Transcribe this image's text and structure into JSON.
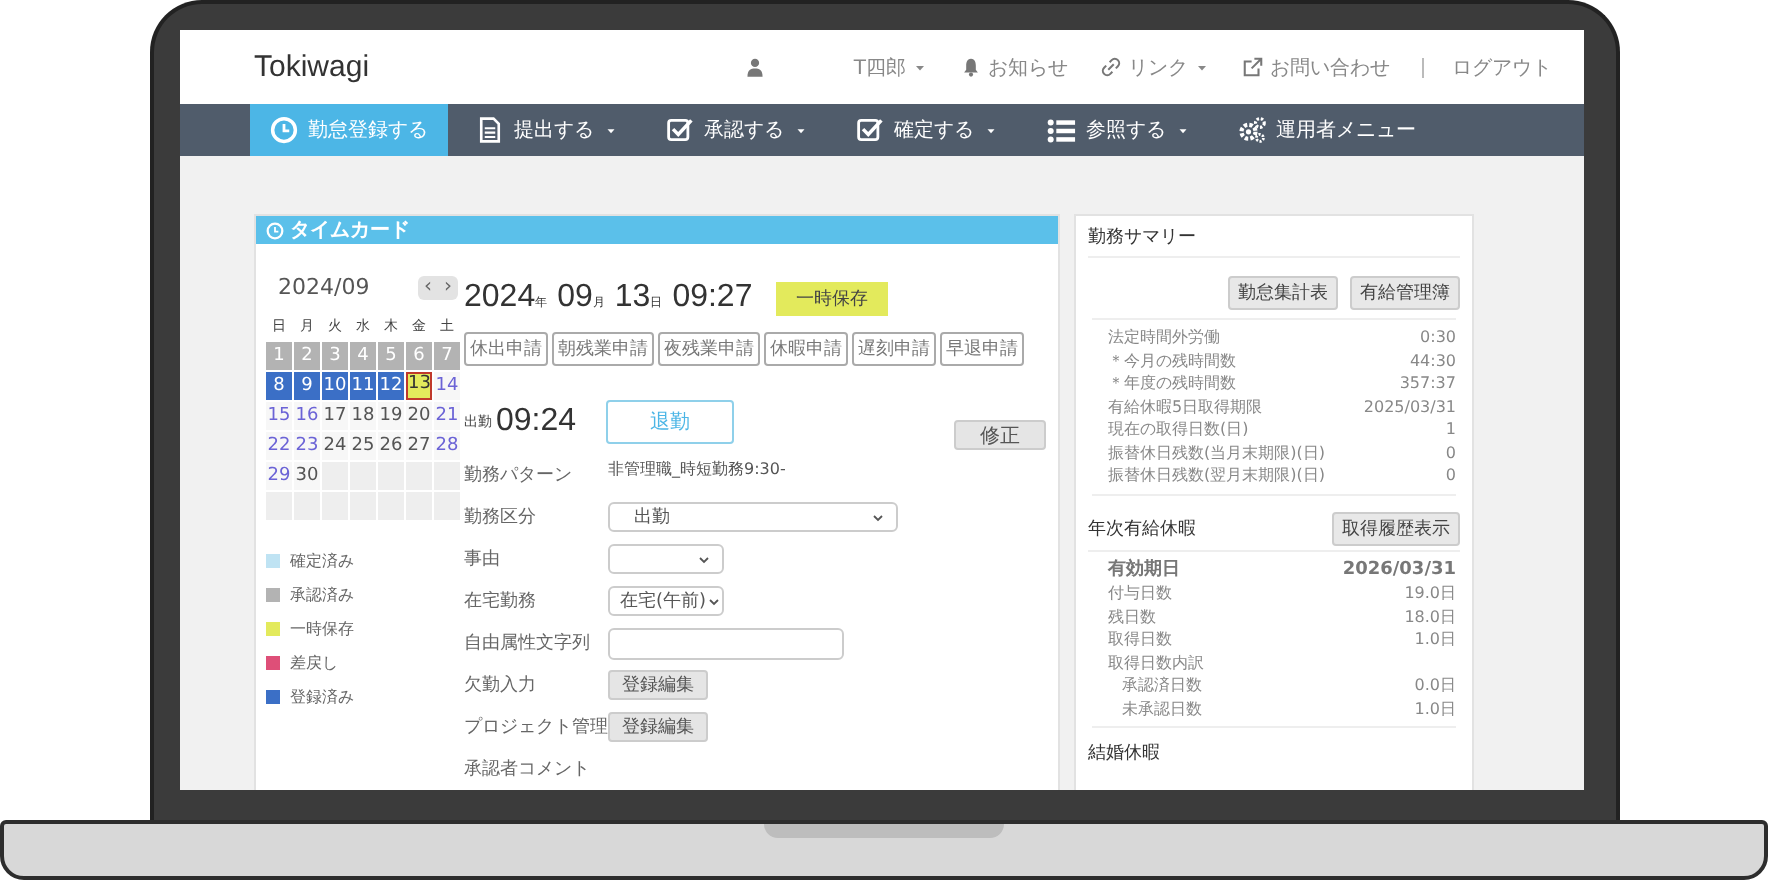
{
  "header": {
    "logo": "Tokiwagi",
    "user_name": "T四郎",
    "links": [
      {
        "label": "お知らせ",
        "kind": "bell",
        "dropdown": false
      },
      {
        "label": "リンク",
        "kind": "link",
        "dropdown": true
      },
      {
        "label": "お問い合わせ",
        "kind": "external",
        "dropdown": false
      },
      {
        "label": "ログアウト",
        "kind": "plain",
        "dropdown": false
      }
    ]
  },
  "nav": [
    {
      "label": "勤怠登録する",
      "kind": "clock",
      "dropdown": false,
      "selected": true
    },
    {
      "label": "提出する",
      "kind": "doc",
      "dropdown": true,
      "selected": false
    },
    {
      "label": "承認する",
      "kind": "check",
      "dropdown": true,
      "selected": false
    },
    {
      "label": "確定する",
      "kind": "check",
      "dropdown": true,
      "selected": false
    },
    {
      "label": "参照する",
      "kind": "list",
      "dropdown": true,
      "selected": false
    },
    {
      "label": "運用者メニュー",
      "kind": "gears",
      "dropdown": false,
      "selected": false
    }
  ],
  "timecard": {
    "title": "タイムカード",
    "month": "2024/09",
    "prev": "‹",
    "next": "›",
    "weekdays": [
      "日",
      "月",
      "火",
      "水",
      "木",
      "金",
      "土"
    ],
    "days": [
      {
        "day": "1",
        "kind": "approved",
        "holiday": false,
        "today": false
      },
      {
        "day": "2",
        "kind": "approved",
        "holiday": false,
        "today": false
      },
      {
        "day": "3",
        "kind": "approved",
        "holiday": false,
        "today": false
      },
      {
        "day": "4",
        "kind": "approved",
        "holiday": false,
        "today": false
      },
      {
        "day": "5",
        "kind": "approved",
        "holiday": false,
        "today": false
      },
      {
        "day": "6",
        "kind": "approved",
        "holiday": false,
        "today": false
      },
      {
        "day": "7",
        "kind": "approved",
        "holiday": false,
        "today": false
      },
      {
        "day": "8",
        "kind": "registered",
        "holiday": false,
        "today": false
      },
      {
        "day": "9",
        "kind": "registered",
        "holiday": false,
        "today": false
      },
      {
        "day": "10",
        "kind": "registered",
        "holiday": false,
        "today": false
      },
      {
        "day": "11",
        "kind": "registered",
        "holiday": false,
        "today": false
      },
      {
        "day": "12",
        "kind": "registered",
        "holiday": false,
        "today": false
      },
      {
        "day": "13",
        "kind": "temporary",
        "holiday": false,
        "today": true
      },
      {
        "day": "14",
        "kind": "plain",
        "holiday": true,
        "today": false
      },
      {
        "day": "15",
        "kind": "plain",
        "holiday": true,
        "today": false
      },
      {
        "day": "16",
        "kind": "plain",
        "holiday": true,
        "today": false
      },
      {
        "day": "17",
        "kind": "plain",
        "holiday": false,
        "today": false
      },
      {
        "day": "18",
        "kind": "plain",
        "holiday": false,
        "today": false
      },
      {
        "day": "19",
        "kind": "plain",
        "holiday": false,
        "today": false
      },
      {
        "day": "20",
        "kind": "plain",
        "holiday": false,
        "today": false
      },
      {
        "day": "21",
        "kind": "plain",
        "holiday": true,
        "today": false
      },
      {
        "day": "22",
        "kind": "plain",
        "holiday": true,
        "today": false
      },
      {
        "day": "23",
        "kind": "plain",
        "holiday": true,
        "today": false
      },
      {
        "day": "24",
        "kind": "plain",
        "holiday": false,
        "today": false
      },
      {
        "day": "25",
        "kind": "plain",
        "holiday": false,
        "today": false
      },
      {
        "day": "26",
        "kind": "plain",
        "holiday": false,
        "today": false
      },
      {
        "day": "27",
        "kind": "plain",
        "holiday": false,
        "today": false
      },
      {
        "day": "28",
        "kind": "plain",
        "holiday": true,
        "today": false
      },
      {
        "day": "29",
        "kind": "plain",
        "holiday": true,
        "today": false
      },
      {
        "day": "30",
        "kind": "plain",
        "holiday": false,
        "today": false
      }
    ],
    "legend": [
      {
        "label": "確定済み",
        "color": "#bfe3f3"
      },
      {
        "label": "承認済み",
        "color": "#b3b3b3"
      },
      {
        "label": "一時保存",
        "color": "#e3ea5c"
      },
      {
        "label": "差戻し",
        "color": "#de4f78"
      },
      {
        "label": "登録済み",
        "color": "#3b6fc6"
      }
    ],
    "date": {
      "year": "2024",
      "year_unit": "年",
      "month": "09",
      "month_unit": "月",
      "day": "13",
      "day_unit": "日",
      "time": "09:27"
    },
    "status_badge": "一時保存",
    "request_buttons": [
      "休出申請",
      "朝残業申請",
      "夜残業申請",
      "休暇申請",
      "遅刻申請",
      "早退申請"
    ],
    "clock_in": {
      "label": "出勤",
      "time": "09:24"
    },
    "clock_out_button": "退勤",
    "fix_button": "修正",
    "fields": [
      {
        "kind": "text",
        "label": "勤務パターン",
        "value": "非管理職_時短勤務9:30-"
      },
      {
        "kind": "select",
        "label": "勤務区分",
        "value": "出勤"
      },
      {
        "kind": "select_small",
        "label": "事由"
      },
      {
        "kind": "select_small",
        "label": "在宅勤務",
        "value": "在宅(午前)"
      },
      {
        "kind": "input",
        "label": "自由属性文字列"
      },
      {
        "kind": "button",
        "label": "欠勤入力",
        "button": "登録編集"
      },
      {
        "kind": "button",
        "label": "プロジェクト管理",
        "button": "登録編集"
      },
      {
        "kind": "label",
        "label": "承認者コメント"
      }
    ]
  },
  "summary": {
    "title": "勤務サマリー",
    "buttons": [
      "勤怠集計表",
      "有給管理簿"
    ],
    "rows": [
      {
        "label": "法定時間外労働",
        "value": "0:30"
      },
      {
        "label": "＊今月の残時間数",
        "value": "44:30"
      },
      {
        "label": "＊年度の残時間数",
        "value": "357:37"
      },
      {
        "label": "有給休暇5日取得期限",
        "value": "2025/03/31"
      },
      {
        "label": "現在の取得日数(日)",
        "value": "1"
      },
      {
        "label": "振替休日残数(当月末期限)(日)",
        "value": "0"
      },
      {
        "label": "振替休日残数(翌月末期限)(日)",
        "value": "0"
      }
    ]
  },
  "paid_leave": {
    "title": "年次有給休暇",
    "button": "取得履歴表示",
    "expiry": {
      "label": "有効期日",
      "value": "2026/03/31"
    },
    "rows": [
      {
        "label": "付与日数",
        "value": "19.0日"
      },
      {
        "label": "残日数",
        "value": "18.0日"
      },
      {
        "label": "取得日数",
        "value": "1.0日"
      },
      {
        "label": "取得日数内訳",
        "children": [
          {
            "label": "承認済日数",
            "value": "0.0日"
          },
          {
            "label": "未承認日数",
            "value": "1.0日"
          }
        ]
      }
    ]
  },
  "next_section": "結婚休暇"
}
